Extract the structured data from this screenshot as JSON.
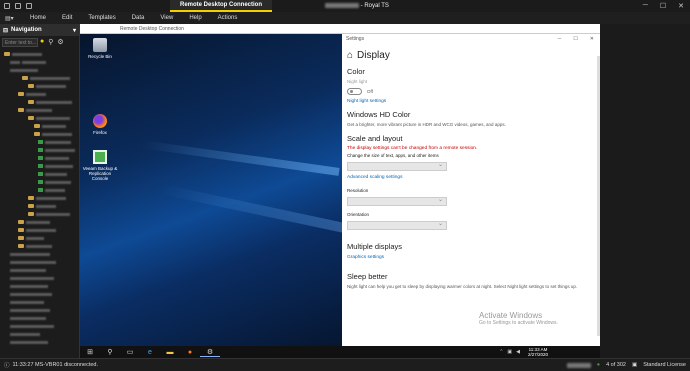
{
  "window": {
    "tab_title": "Remote Desktop Connection",
    "app_title": "Royal TS"
  },
  "menu": [
    "Home",
    "Edit",
    "Templates",
    "Data",
    "View",
    "Help",
    "Actions"
  ],
  "navigation": {
    "title": "Navigation",
    "search_placeholder": "Enter text to..."
  },
  "rdp": {
    "title": "Remote Desktop Connection",
    "desktop_icons": [
      {
        "label": "Recycle Bin",
        "icon": "recycle-bin-icon"
      },
      {
        "label": "Firefox",
        "icon": "firefox-icon"
      },
      {
        "label": "Veeam Backup & Replication Console",
        "icon": "veeam-icon"
      }
    ],
    "taskbar": {
      "time": "11:33 AM",
      "date": "2/27/2020"
    }
  },
  "settings": {
    "window_title": "Settings",
    "page_title": "Display",
    "color_header": "Color",
    "night_light_label": "Night light",
    "night_light_state": "Off",
    "night_light_settings": "Night light settings",
    "hd_color_header": "Windows HD Color",
    "hd_color_desc": "Get a brighter, more vibrant picture in HDR and WCG videos, games, and apps.",
    "scale_header": "Scale and layout",
    "scale_warning": "The display settings can't be changed from a remote session.",
    "scale_desc": "Change the size of text, apps, and other items",
    "advanced_scaling": "Advanced scaling settings",
    "resolution_label": "Resolution",
    "orientation_label": "Orientation",
    "multiple_header": "Multiple displays",
    "graphics_settings": "Graphics settings",
    "sleep_header": "Sleep better",
    "sleep_desc": "Night light can help you get to sleep by displaying warmer colors at night. Select Night light settings to set things up."
  },
  "activation": {
    "title": "Activate Windows",
    "subtitle": "Go to Settings to activate Windows."
  },
  "status": {
    "message": "11:33:27 MS-VBR01 disconnected.",
    "count": "4 of 302",
    "license": "Standard License"
  },
  "colors": {
    "accent": "#f5d000",
    "link": "#0067b8",
    "warning": "#c00000"
  }
}
